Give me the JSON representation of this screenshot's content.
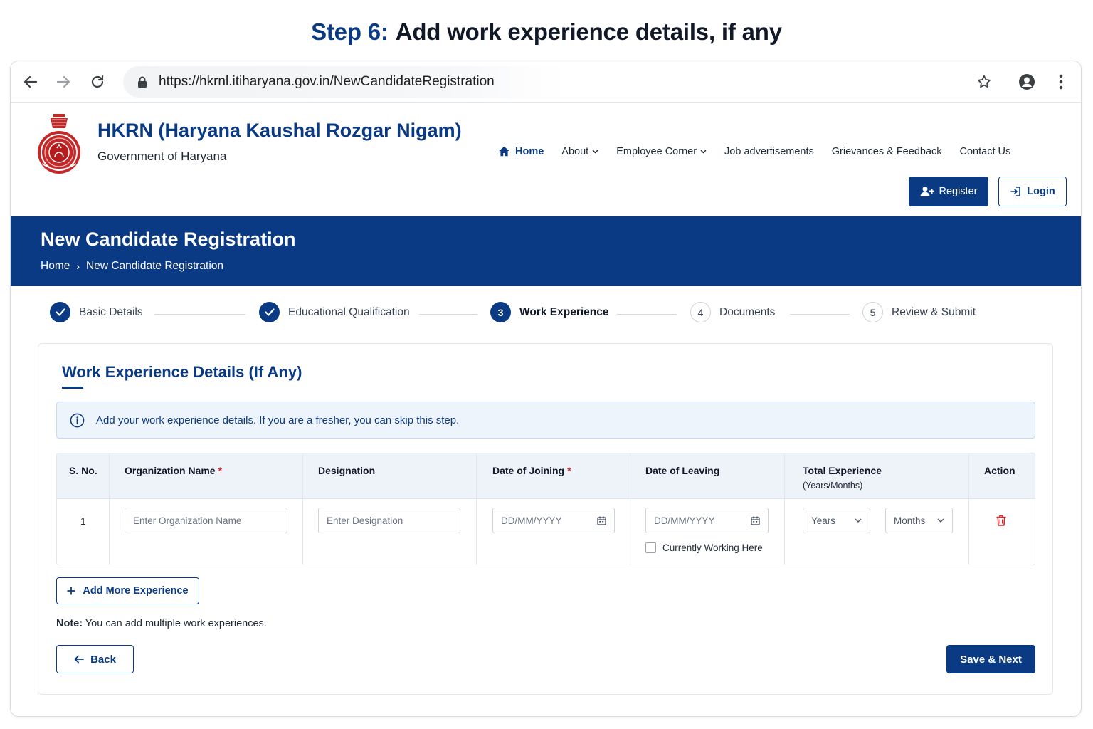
{
  "step_heading": {
    "number": "Step 6:",
    "text": "Add work experience details, if any"
  },
  "browser": {
    "url": "https://hkrnl.itiharyana.gov.in/NewCandidateRegistration"
  },
  "header": {
    "org_title": "HKRN (Haryana Kaushal Rozgar Nigam)",
    "org_subtitle": "Government of Haryana",
    "nav": [
      {
        "label": "Home",
        "active": true,
        "icon": "home-icon"
      },
      {
        "label": "About",
        "dropdown": true
      },
      {
        "label": "Employee Corner",
        "dropdown": true
      },
      {
        "label": "Job advertisements"
      },
      {
        "label": "Grievances & Feedback"
      },
      {
        "label": "Contact Us"
      }
    ],
    "register_label": "Register",
    "login_label": "Login"
  },
  "banner": {
    "title": "New Candidate Registration",
    "breadcrumb": [
      "Home",
      "New Candidate Registration"
    ]
  },
  "stepper": [
    {
      "label": "Basic Details",
      "state": "done"
    },
    {
      "label": "Educational Qualification",
      "state": "done"
    },
    {
      "number": "3",
      "label": "Work Experience",
      "state": "current"
    },
    {
      "number": "4",
      "label": "Documents",
      "state": "todo"
    },
    {
      "number": "5",
      "label": "Review & Submit",
      "state": "todo"
    }
  ],
  "form": {
    "title": "Work Experience Details (If Any)",
    "info": "Add your work experience details. If you are a fresher, you can skip this step.",
    "table": {
      "headers": {
        "sno": "S. No.",
        "org": "Organization Name",
        "designation": "Designation",
        "doj": "Date of Joining",
        "dol": "Date of Leaving",
        "total": "Total Experience",
        "total_sub": "(Years/Months)",
        "action": "Action"
      },
      "required_mark": "*",
      "rows": [
        {
          "sno": "1",
          "org_placeholder": "Enter Organization Name",
          "designation_placeholder": "Enter Designation",
          "doj_placeholder": "DD/MM/YYYY",
          "dol_placeholder": "DD/MM/YYYY",
          "currently_working_label": "Currently Working Here",
          "currently_working": false,
          "years_label": "Years",
          "months_label": "Months"
        }
      ]
    },
    "add_more_label": "Add More Experience",
    "note_label": "Note:",
    "note_text": " You can add multiple work experiences.",
    "back_label": "Back",
    "save_label": "Save & Next"
  },
  "colors": {
    "primary": "#0a3a84",
    "required": "#d62828",
    "info_bg": "#eef4fb"
  }
}
